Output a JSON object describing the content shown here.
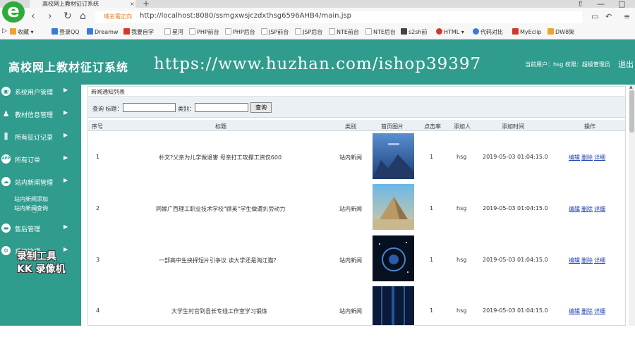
{
  "browser": {
    "logo_letter": "e",
    "tab_title": "高校网上教材征订系统",
    "tab_close": "×",
    "tab_new": "+",
    "win_controls": [
      "⇧",
      "—",
      "□"
    ],
    "address_warning": "域名需正向",
    "url": "http://localhost:8080/ssmgxwsjczdxthsg6596AHB4/main.jsp",
    "nav_back": "‹",
    "nav_forward": "›",
    "nav_reload": "↻",
    "nav_home": "⌂"
  },
  "favorites": [
    {
      "label": "收藏 ▾",
      "color": "#e8a530"
    },
    {
      "label": "登录QQ",
      "color": "#3b7bd6"
    },
    {
      "label": "Dreamw",
      "color": "#3b7bd6"
    },
    {
      "label": "我要自学",
      "color": "#d03a2a"
    },
    {
      "label": "星河",
      "color": "#bbbbbb"
    },
    {
      "label": "PHP前台",
      "color": "#bbbbbb"
    },
    {
      "label": "PHP后台",
      "color": "#bbbbbb"
    },
    {
      "label": "JSP前台",
      "color": "#bbbbbb"
    },
    {
      "label": "JSP后台",
      "color": "#bbbbbb"
    },
    {
      "label": "NTE前台",
      "color": "#bbbbbb"
    },
    {
      "label": "NTE后台",
      "color": "#bbbbbb"
    },
    {
      "label": "s2sh前",
      "color": "#444444"
    },
    {
      "label": "HTML ▾",
      "color": "#d03a2a"
    },
    {
      "label": "代码对比",
      "color": "#3b7bd6"
    },
    {
      "label": "MyEclip",
      "color": "#d03a2a"
    },
    {
      "label": "DW8架",
      "color": "#e8a530"
    }
  ],
  "header": {
    "title": "高校网上教材征订系统",
    "watermark": "https://www.huzhan.com/ishop39397",
    "user_info": "当前用户：hsg 权限：超级管理员",
    "logout": "退出"
  },
  "sidebar": {
    "items": [
      {
        "label": "系统用户管理",
        "icon": "monitor-icon",
        "glyph": "▣"
      },
      {
        "label": "教材信息管理",
        "icon": "users-icon",
        "glyph": "♟"
      },
      {
        "label": "所有征订记录",
        "icon": "chart-icon",
        "glyph": "⫼"
      },
      {
        "label": "所有订单",
        "icon": "app-icon",
        "glyph": "APP"
      },
      {
        "label": "站内新闻管理",
        "icon": "cloud-icon",
        "glyph": "☁"
      },
      {
        "label": "售后管理",
        "icon": "briefcase-icon",
        "glyph": "▬"
      },
      {
        "label": "系统管理",
        "icon": "gear-icon",
        "glyph": "⚙"
      }
    ],
    "sub_items": [
      "站内新闻添加",
      "站内新闻查询"
    ],
    "arrow": "▶",
    "overlay_text": [
      "录制工具",
      "KK 录像机"
    ]
  },
  "panel": {
    "title": "新闻通知列表",
    "search_prefix": "查询 标题：",
    "category_label": "类别：",
    "title_value": "",
    "category_value": "",
    "search_button": "查询"
  },
  "table": {
    "columns": [
      "序号",
      "标题",
      "类别",
      "首页图片",
      "点击率",
      "添加人",
      "添加时间",
      "操作"
    ],
    "rows": [
      {
        "no": "1",
        "title": "朴文?父亲为儿学做退害 母亲打工攻撑工资仅600",
        "category": "站内新闻",
        "clicks": "1",
        "adder": "hsg",
        "time": "2019-05-03 01:04:15.0",
        "thumb": "blue"
      },
      {
        "no": "2",
        "title": "同嫁广西理工职业技术学校\"顾奚\"学生做遭扒劳动力",
        "category": "站内新闻",
        "clicks": "1",
        "adder": "hsg",
        "time": "2019-05-03 01:04:15.0",
        "thumb": "pyramid"
      },
      {
        "no": "3",
        "title": "一部高中生抉择短片引争议 读大学还是淘江猫？",
        "category": "站内新闻",
        "clicks": "1",
        "adder": "hsg",
        "time": "2019-05-03 01:04:15.0",
        "thumb": "space"
      },
      {
        "no": "4",
        "title": "大学生村官到县长专线工作室学习锻炼",
        "category": "站内新闻",
        "clicks": "1",
        "adder": "hsg",
        "time": "2019-05-03 01:04:15.0",
        "thumb": "tunnel"
      }
    ],
    "actions": [
      "编辑",
      "删除",
      "详细"
    ]
  }
}
